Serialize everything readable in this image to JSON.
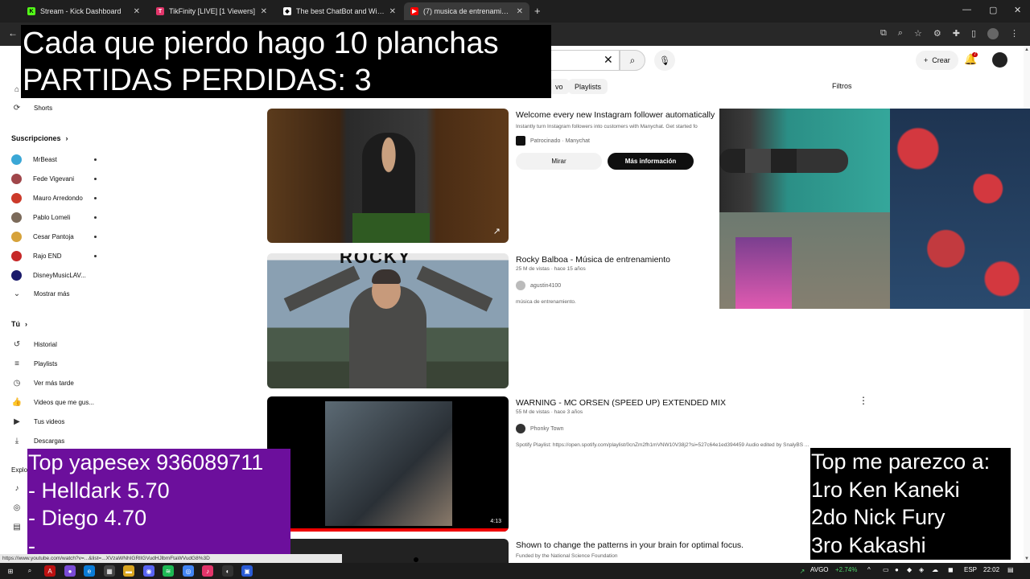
{
  "browser": {
    "tabs": [
      {
        "label": "Stream - Kick Dashboard",
        "favicon": "kick-icon",
        "color": "#53fc18"
      },
      {
        "label": "TikFinity [LIVE] [1 Viewers]",
        "favicon": "tikfinity-icon",
        "color": "#e2356a"
      },
      {
        "label": "The best ChatBot and Widgets",
        "favicon": "streamelements-icon",
        "color": "#ffffff"
      },
      {
        "label": "(7) musica de entrenamiento",
        "favicon": "youtube-icon",
        "color": "#ff0000"
      }
    ],
    "close_glyph": "✕",
    "new_tab_glyph": "+",
    "status_url": "https://www.youtube.com/watch?v=...&list=...XVzaWNhIGRlIGVudHJlbmFtaWVudG8%3D"
  },
  "youtube": {
    "chips": [
      "vo",
      "Playlists"
    ],
    "filters_label": "Filtros",
    "create_label": "Crear",
    "notification_count": "7",
    "sidebar": {
      "shorts_label": "Shorts",
      "subscriptions_title": "Suscripciones",
      "subscriptions": [
        {
          "name": "MrBeast",
          "color": "#3aa7d6"
        },
        {
          "name": "Fede Vigevani",
          "color": "#a0464a"
        },
        {
          "name": "Mauro Arredondo",
          "color": "#cc3a2a"
        },
        {
          "name": "Pablo Lomeli",
          "color": "#7b6a5a"
        },
        {
          "name": "Cesar Pantoja",
          "color": "#d6a23a"
        },
        {
          "name": "Rajo END",
          "color": "#c62828"
        },
        {
          "name": "DisneyMusicLAV...",
          "color": "#1a1a6a"
        }
      ],
      "show_more_label": "Mostrar más",
      "you_title": "Tú",
      "you_items": [
        {
          "label": "Historial",
          "icon": "history-icon"
        },
        {
          "label": "Playlists",
          "icon": "playlist-icon"
        },
        {
          "label": "Ver más tarde",
          "icon": "clock-icon"
        },
        {
          "label": "Videos que me gus...",
          "icon": "like-icon"
        },
        {
          "label": "Tus videos",
          "icon": "video-icon"
        },
        {
          "label": "Descargas",
          "icon": "download-icon"
        }
      ],
      "explore_title": "Explo"
    },
    "results": [
      {
        "title": "Welcome every new Instagram follower automatically",
        "meta": "Instantly turn Instagram followers into customers with Manychat. Get started fo",
        "channel": "Patrocinado · Manychat",
        "watch_label": "Mirar",
        "more_label": "Más información"
      },
      {
        "title": "Rocky Balboa - Música de entrenamiento",
        "meta": "25 M de vistas · hace 15 años",
        "channel": "agustin4100",
        "description": "música de entrenamiento.",
        "thumb_text": "ROCKY"
      },
      {
        "title": "WARNING - MC ORSEN (SPEED UP) EXTENDED MIX",
        "meta": "55 M de vistas · hace 3 años",
        "channel": "Phonky Town",
        "description": "Spotify Playlist: https://open.spotify.com/playlist/0cnZm2fh1mVNW10V38j2?si=527c64e1ed394459 Audio edited by SnalyBS ...",
        "duration": "4:13"
      },
      {
        "title": "Shown to change the patterns in your brain for optimal focus.",
        "meta": "Funded by the National Science Foundation"
      }
    ]
  },
  "overlays": {
    "top_lines": [
      "Cada que pierdo hago 10 planchas",
      "PARTIDAS PERDIDAS: 3"
    ],
    "left_lines": [
      "Top yapesex 936089711",
      "- Helldark 5.70",
      "- Diego 4.70",
      "-"
    ],
    "right_lines": [
      "Top me parezco a:",
      "1ro Ken Kaneki",
      "2do Nick Fury",
      "3ro Kakashi"
    ]
  },
  "taskbar": {
    "ticker": "AVGO",
    "ticker_change": "+2.74%",
    "lang": "ESP",
    "time": "22:02"
  },
  "colors": {
    "left_overlay_bg": "#6c0f9c",
    "overlay_black": "#000000",
    "youtube_red": "#ff0000"
  }
}
